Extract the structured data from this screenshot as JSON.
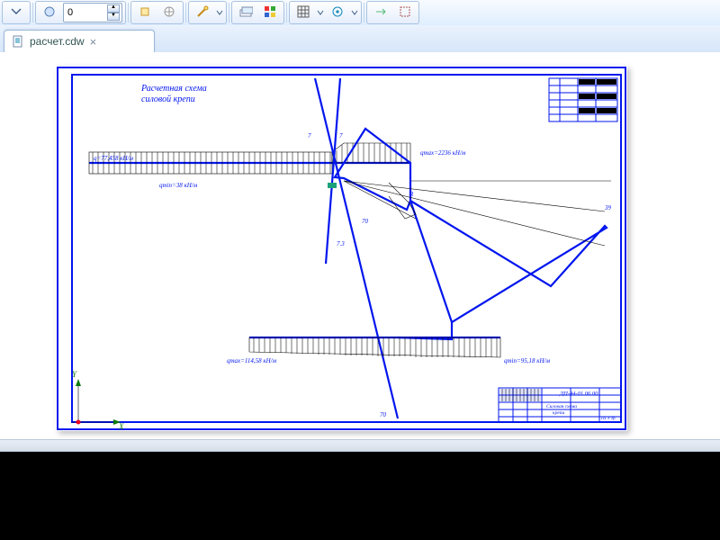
{
  "toolbar": {
    "spinner_value": "0"
  },
  "tab": {
    "filename": "расчет.cdw",
    "close": "×"
  },
  "drawing": {
    "title_line1": "Расчетная схема",
    "title_line2": "силовой крепи",
    "lbl_q_left": "q=77,458 кН/м",
    "lbl_qmin_aw": "qmin=38 кН/м",
    "lbl_qmax_right": "qmax=2236 кН/м",
    "lbl_qmax_bottom": "qmax=114,58 кН/м",
    "lbl_qmin_bottom_r": "qmin=95,18 кН/м",
    "dim_7": "7",
    "dim_7_2": "7",
    "dim_70": "70",
    "dim_70_2": "70",
    "dim_39": "39",
    "dim_7_3": "7.3",
    "note_r": "R",
    "coord_x": "X",
    "coord_y": "Y",
    "titleblock_main": "ДП-44-01.06.00",
    "titleblock_sub1": "Силовая схема",
    "titleblock_sub2": "крепи",
    "titleblock_uni": "ПГУ гр."
  }
}
